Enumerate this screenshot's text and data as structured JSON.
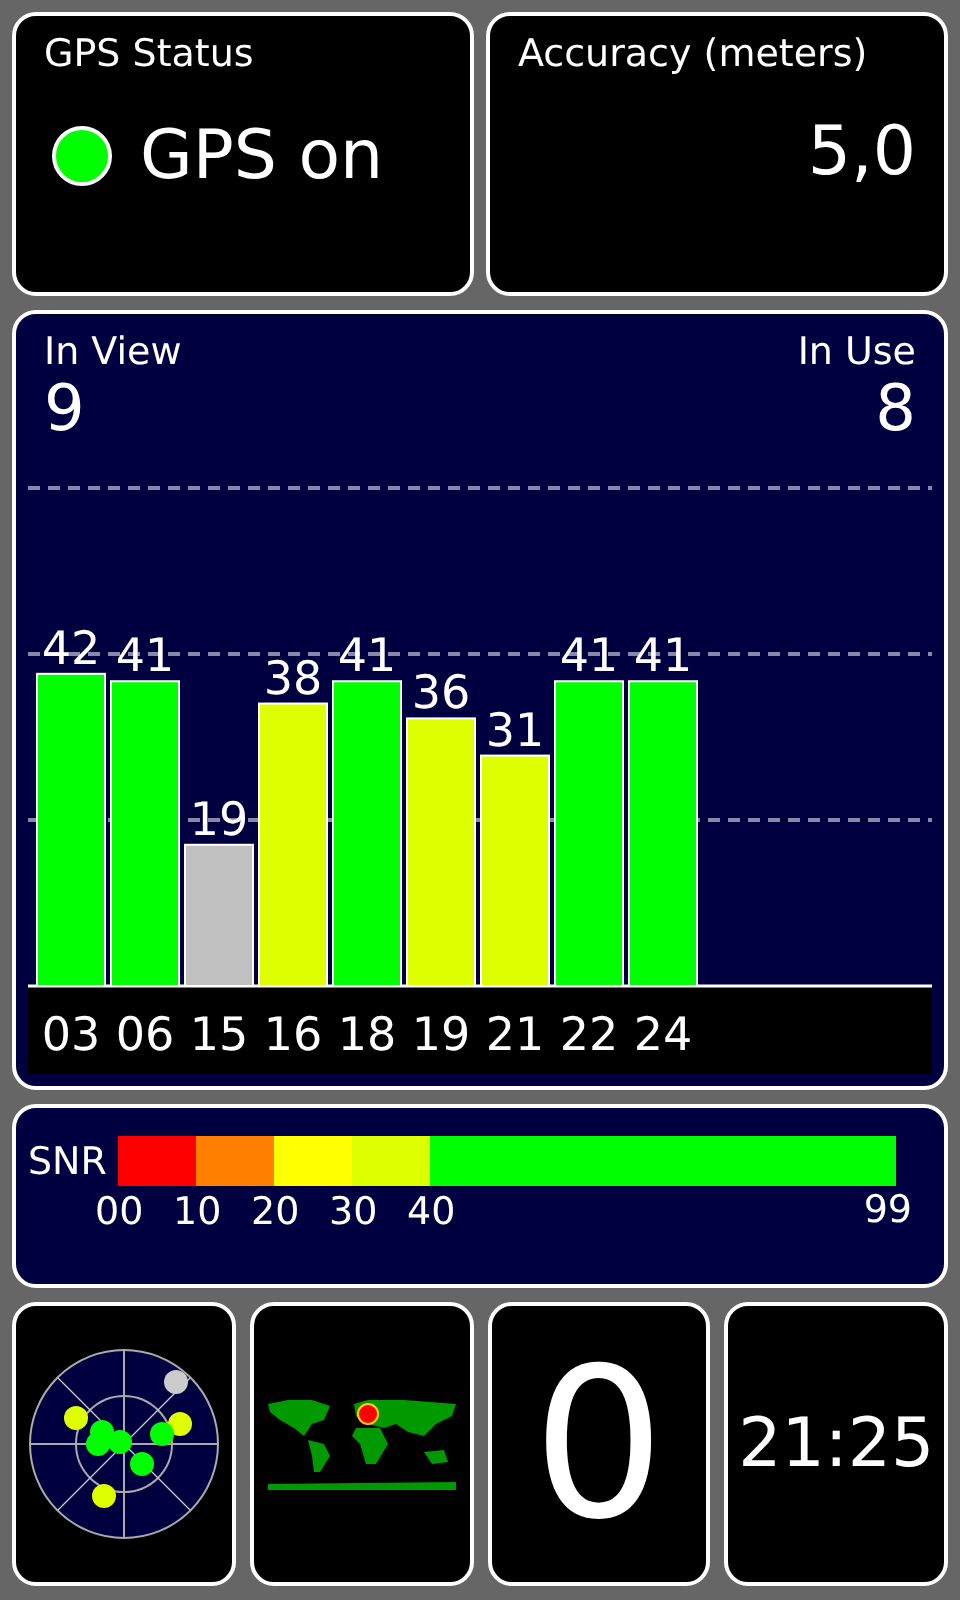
{
  "gps_status": {
    "title": "GPS Status",
    "on": true,
    "value": "GPS on"
  },
  "accuracy": {
    "title": "Accuracy (meters)",
    "value": "5,0"
  },
  "satellites": {
    "in_view_label": "In View",
    "in_view": "9",
    "in_use_label": "In Use",
    "in_use": "8",
    "chart_data": {
      "type": "bar",
      "categories": [
        "03",
        "06",
        "15",
        "16",
        "18",
        "19",
        "21",
        "22",
        "24"
      ],
      "ylim": [
        0,
        67
      ],
      "data_labels": true,
      "series": [
        {
          "color": "#00ff00",
          "values": [
            42,
            41,
            null,
            null,
            41,
            null,
            null,
            41,
            41
          ]
        },
        {
          "color": "#ddff00",
          "values": [
            null,
            null,
            null,
            38,
            null,
            36,
            31,
            null,
            null
          ]
        },
        {
          "color": "#c0c0c0",
          "values": [
            null,
            null,
            19,
            null,
            null,
            null,
            null,
            null,
            null
          ]
        }
      ]
    }
  },
  "snr": {
    "label": "SNR",
    "segments": [
      {
        "label": "00",
        "color": "#ff0000"
      },
      {
        "label": "10",
        "color": "#ff8000"
      },
      {
        "label": "20",
        "color": "#ffff00"
      },
      {
        "label": "30",
        "color": "#ddff00"
      },
      {
        "label": "40",
        "color": "#00ff00"
      }
    ],
    "end_label": "99"
  },
  "bottom": {
    "count": "0",
    "time": "21:25"
  }
}
